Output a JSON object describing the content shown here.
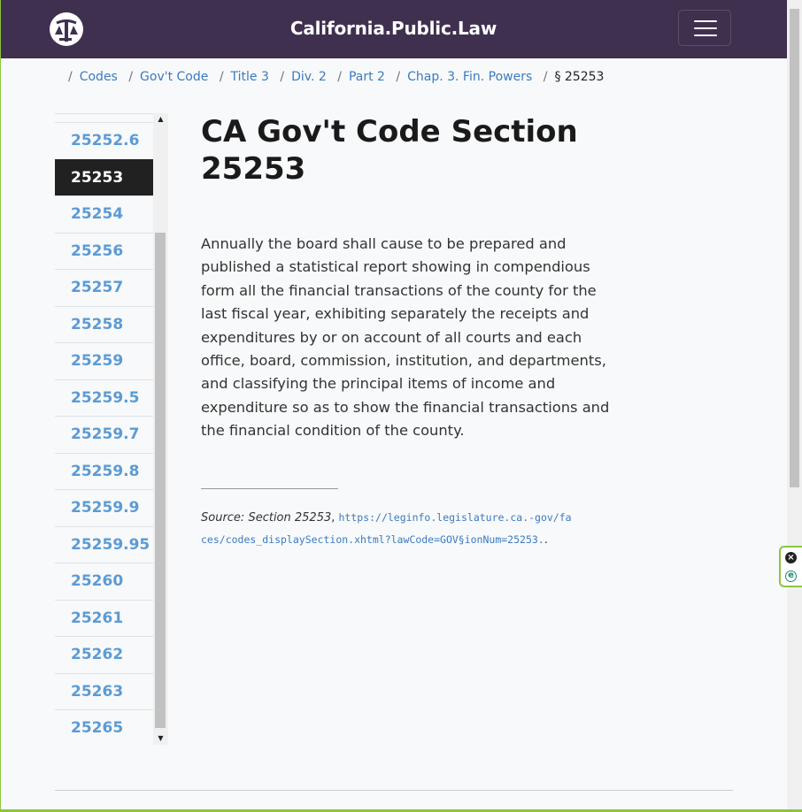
{
  "header": {
    "site_title": "California.Public.Law",
    "logo_icon": "scales-logo-icon",
    "menu_icon": "hamburger-menu-icon"
  },
  "breadcrumb": {
    "items": [
      "Codes",
      "Gov't Code",
      "Title 3",
      "Div. 2",
      "Part 2",
      "Chap. 3. Fin. Powers"
    ],
    "current": "§ 25253"
  },
  "sidebar": {
    "items": [
      "25252.6",
      "25253",
      "25254",
      "25256",
      "25257",
      "25258",
      "25259",
      "25259.5",
      "25259.7",
      "25259.8",
      "25259.9",
      "25259.95",
      "25260",
      "25261",
      "25262",
      "25263",
      "25265"
    ],
    "active": "25253"
  },
  "main": {
    "heading": "CA Gov't Code Section 25253",
    "body": "Annually the board shall cause to be prepared and published a statistical report showing in compendious form all the financial transactions of the county for the last fiscal year, exhibiting separately the receipts and expenditures by or on account of all courts and each office, board, commission, institution, and departments, and classifying the principal items of income and expenditure so as to show the financial transactions and the financial condition of the county.",
    "source_label": "Source: Section 25253",
    "source_url": "https://leginfo.legislature.ca.-gov/faces/codes_displaySection.xhtml?lawCode=GOV§ionNum=25253.",
    "source_end": "."
  },
  "colors": {
    "navbar": "#3f3050",
    "link": "#3a7bbf",
    "sidebar_link": "#5b9bd5",
    "active_bg": "#212121",
    "frame_accent": "#8cc63f"
  }
}
